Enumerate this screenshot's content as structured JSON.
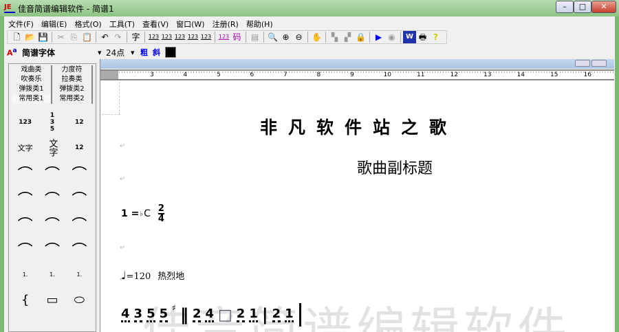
{
  "window": {
    "title": "佳音简谱编辑软件 - 简谱1",
    "icon": "JE",
    "minimize": "–",
    "maximize": "□",
    "close": "✕"
  },
  "menu": [
    "文件(F)",
    "编辑(E)",
    "格式(O)",
    "工具(T)",
    "查看(V)",
    "窗口(W)",
    "注册(R)",
    "帮助(H)"
  ],
  "toolbar": [
    {
      "name": "new-icon",
      "g": "🗋"
    },
    {
      "name": "open-icon",
      "g": "📂"
    },
    {
      "name": "save-icon",
      "g": "💾"
    },
    {
      "sep": true
    },
    {
      "name": "cut-icon",
      "g": "✂"
    },
    {
      "name": "copy-icon",
      "g": "⎘"
    },
    {
      "name": "paste-icon",
      "g": "📋"
    },
    {
      "sep": true
    },
    {
      "name": "undo-icon",
      "g": "↶"
    },
    {
      "name": "redo-icon",
      "g": "↷"
    },
    {
      "sep": true
    },
    {
      "name": "char-button",
      "g": "字"
    },
    {
      "sep": true
    },
    {
      "name": "underline-1-icon",
      "g": "123"
    },
    {
      "name": "underline-2-icon",
      "g": "123"
    },
    {
      "name": "underline-3-icon",
      "g": "123"
    },
    {
      "name": "underline-4-icon",
      "g": "123"
    },
    {
      "name": "underline-5-icon",
      "g": "123"
    },
    {
      "sep": true
    },
    {
      "name": "numbered-icon",
      "g": "123"
    },
    {
      "name": "code-icon",
      "g": "码"
    },
    {
      "sep": true
    },
    {
      "name": "properties-icon",
      "g": "▤"
    },
    {
      "sep": true
    },
    {
      "name": "zoom-fit-icon",
      "g": "🔍"
    },
    {
      "name": "zoom-in-icon",
      "g": "⊕"
    },
    {
      "name": "zoom-out-icon",
      "g": "⊖"
    },
    {
      "sep": true
    },
    {
      "name": "hand-icon",
      "g": "✋"
    },
    {
      "sep": true
    },
    {
      "name": "group-icon",
      "g": "▚"
    },
    {
      "name": "ungroup-icon",
      "g": "▞"
    },
    {
      "name": "lock-icon",
      "g": "🔒"
    },
    {
      "sep": true
    },
    {
      "name": "play-icon",
      "g": "▶"
    },
    {
      "name": "stop-icon",
      "g": "◉"
    },
    {
      "sep": true
    },
    {
      "name": "word-icon",
      "g": "W"
    },
    {
      "name": "print-icon",
      "g": "🖶"
    },
    {
      "name": "help-icon",
      "g": "?"
    }
  ],
  "format": {
    "font": "简谱字体",
    "size": "24点",
    "bold": "粗",
    "italic": "斜",
    "color": "#000000"
  },
  "palette": {
    "tabs": [
      "戏曲类",
      "力度符",
      "吹奏乐",
      "拉奏类",
      "弹拨类1",
      "弹拨类2",
      "常用类1",
      "常用类2"
    ],
    "active_tab": "常用类1",
    "items": [
      "123",
      "1 3 5",
      "12",
      "文字",
      "文字",
      "12",
      "⌒",
      "⌒",
      "⌒",
      "⌒",
      "⌒",
      "⌒",
      "⌒",
      "⌒",
      "⌒",
      "⌒",
      "⌒",
      "⌒",
      "1.",
      "1.",
      "1.",
      "{",
      "▭",
      "⬭"
    ]
  },
  "ruler": [
    "3",
    "4",
    "5",
    "6",
    "7",
    "8",
    "9",
    "10",
    "11",
    "12",
    "13",
    "14",
    "15",
    "16"
  ],
  "score": {
    "title": "非凡软件站之歌",
    "subtitle": "歌曲副标题",
    "key_prefix": "1 =",
    "key_flat": "♭",
    "key": "C",
    "time_top": "2",
    "time_bottom": "4",
    "tempo": "=120",
    "tempo_text": "热烈地",
    "notes": [
      "4",
      "3",
      "5",
      "5",
      "♯",
      "‖",
      "2",
      "4",
      "□",
      "2",
      "1",
      "|",
      "2",
      "1"
    ]
  },
  "watermark": "佳音简谱编辑软件"
}
